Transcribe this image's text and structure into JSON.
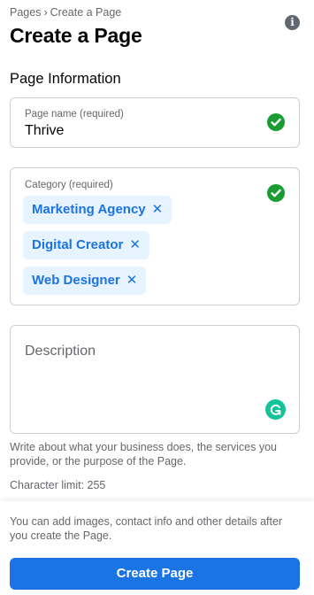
{
  "breadcrumb": {
    "items": [
      "Pages",
      "Create a Page"
    ],
    "separator": "›"
  },
  "header": {
    "title": "Create a Page",
    "info_icon": "info-icon"
  },
  "section": {
    "title": "Page Information"
  },
  "page_name": {
    "label": "Page name (required)",
    "value": "Thrive",
    "valid": true
  },
  "category": {
    "label": "Category (required)",
    "valid": true,
    "chips": [
      {
        "label": "Marketing Agency",
        "remove": "✕"
      },
      {
        "label": "Digital Creator",
        "remove": "✕"
      },
      {
        "label": "Web Designer",
        "remove": "✕"
      }
    ]
  },
  "description": {
    "placeholder": "Description",
    "value": ""
  },
  "helper_text": "Write about what your business does, the services you provide, or the purpose of the Page.",
  "char_limit": "Character limit: 255",
  "footer": {
    "note": "You can add images, contact info and other details after you create the Page.",
    "create_button": "Create Page"
  },
  "colors": {
    "primary": "#1b74e4",
    "chip_bg": "#e7f3ff",
    "success": "#1a9c32",
    "grammarly": "#15c39a",
    "muted_text": "#65676b"
  }
}
